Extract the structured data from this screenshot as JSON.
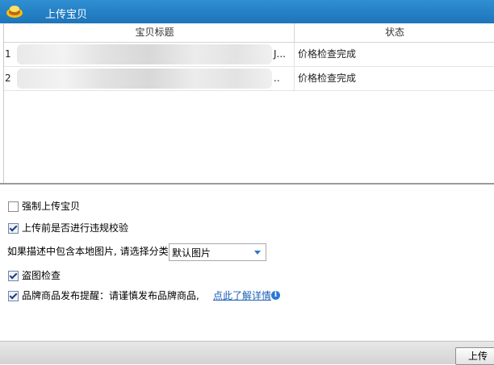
{
  "window": {
    "title": "上传宝贝",
    "icon": "app-logo-icon"
  },
  "grid": {
    "headers": {
      "title": "宝贝标题",
      "status": "状态"
    },
    "rows": [
      {
        "num": "1",
        "title_suffix": "J...",
        "status": "价格检查完成"
      },
      {
        "num": "2",
        "title_suffix": "..",
        "status": "价格检查完成"
      }
    ]
  },
  "options": {
    "force_upload": {
      "label": "强制上传宝贝",
      "checked": false
    },
    "violation_check": {
      "label": "上传前是否进行违规校验",
      "checked": true
    },
    "category": {
      "label": "如果描述中包含本地图片, 请选择分类",
      "selected": "默认图片"
    },
    "image_theft_check": {
      "label": "盗图检查",
      "checked": true
    },
    "brand_reminder": {
      "label": "品牌商品发布提醒：请谨慎发布品牌商品,",
      "link": "点此了解详情",
      "info_icon": "info-icon",
      "checked": true
    }
  },
  "footer": {
    "upload_label": "上传"
  },
  "colors": {
    "titlebar": "#1d74b9",
    "link": "#1a5fb4",
    "accent": "#2a78d6"
  }
}
